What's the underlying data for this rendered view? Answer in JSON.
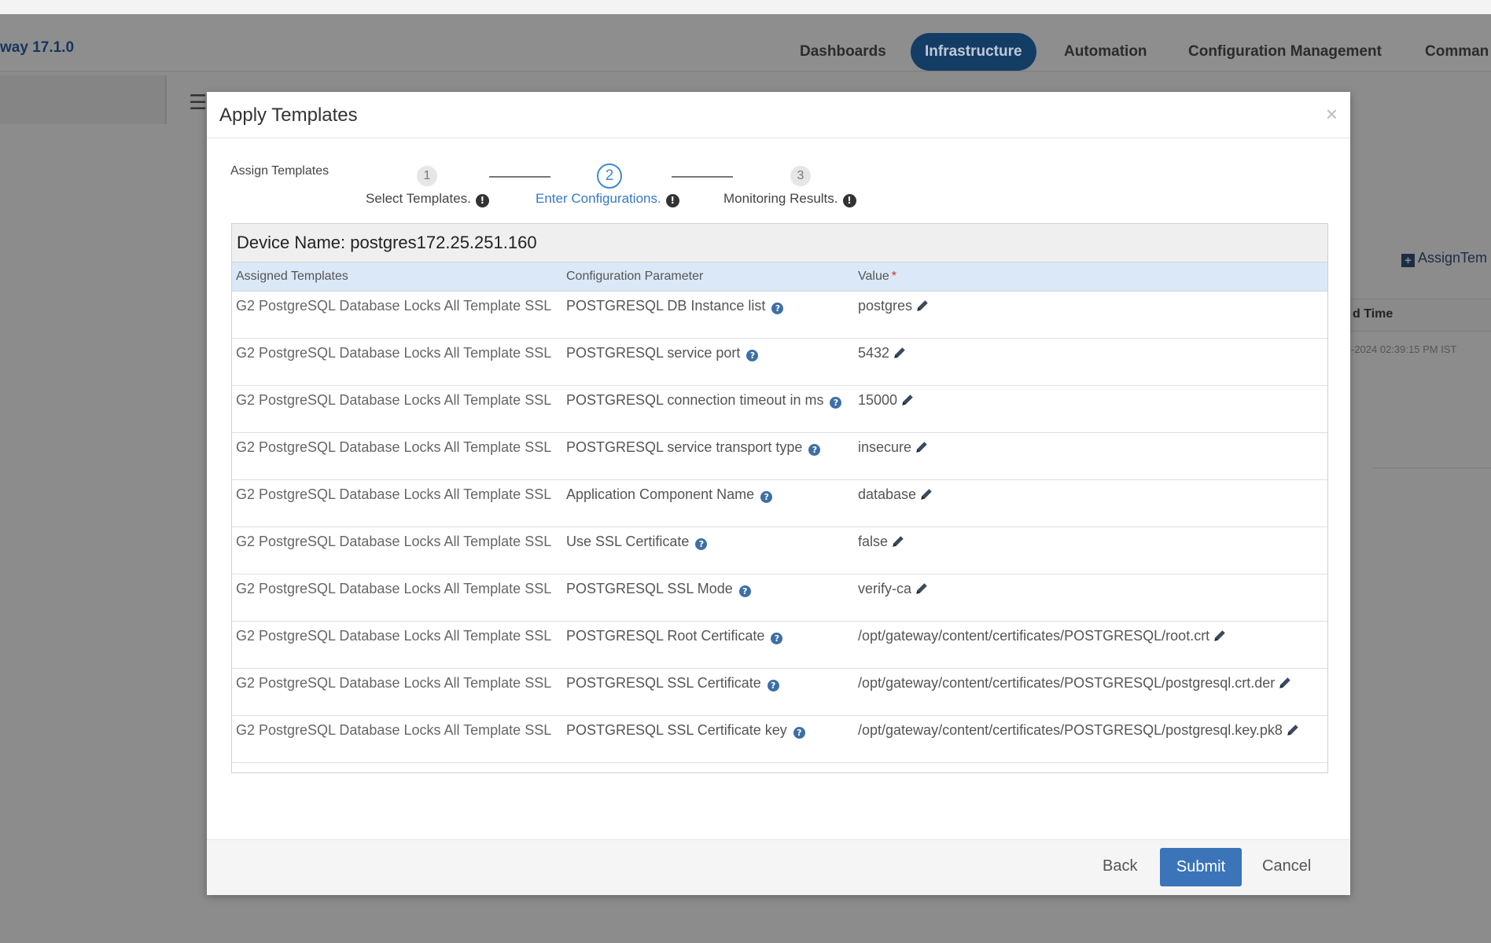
{
  "app": {
    "brand": "way 17.1.0"
  },
  "nav": {
    "items": [
      {
        "label": "Dashboards",
        "active": false
      },
      {
        "label": "Infrastructure",
        "active": true
      },
      {
        "label": "Automation",
        "active": false
      },
      {
        "label": "Configuration Management",
        "active": false
      },
      {
        "label": "Comman",
        "active": false
      }
    ]
  },
  "background": {
    "assign_label": "AssignTem",
    "column_header": "d Time",
    "cell": "-2024 02:39:15 PM IST"
  },
  "modal": {
    "title": "Apply Templates",
    "close_symbol": "×",
    "wizard": {
      "label": "Assign Templates",
      "steps": [
        {
          "number": "1",
          "label": "Select Templates.",
          "active": false
        },
        {
          "number": "2",
          "label": "Enter Configurations.",
          "active": true
        },
        {
          "number": "3",
          "label": "Monitoring Results.",
          "active": false
        }
      ]
    },
    "device_name": "Device Name: postgres172.25.251.160",
    "table": {
      "headers": {
        "template": "Assigned Templates",
        "parameter": "Configuration Parameter",
        "value": "Value"
      },
      "required_marker": "*",
      "rows": [
        {
          "template": "G2 PostgreSQL Database Locks All Template SSL",
          "parameter": "POSTGRESQL DB Instance list",
          "value": "postgres"
        },
        {
          "template": "G2 PostgreSQL Database Locks All Template SSL",
          "parameter": "POSTGRESQL service port",
          "value": "5432"
        },
        {
          "template": "G2 PostgreSQL Database Locks All Template SSL",
          "parameter": "POSTGRESQL connection timeout in ms",
          "value": "15000"
        },
        {
          "template": "G2 PostgreSQL Database Locks All Template SSL",
          "parameter": "POSTGRESQL service transport type",
          "value": "insecure"
        },
        {
          "template": "G2 PostgreSQL Database Locks All Template SSL",
          "parameter": "Application Component Name",
          "value": "database"
        },
        {
          "template": "G2 PostgreSQL Database Locks All Template SSL",
          "parameter": "Use SSL Certificate",
          "value": "false"
        },
        {
          "template": "G2 PostgreSQL Database Locks All Template SSL",
          "parameter": "POSTGRESQL SSL Mode",
          "value": "verify-ca"
        },
        {
          "template": "G2 PostgreSQL Database Locks All Template SSL",
          "parameter": "POSTGRESQL Root Certificate",
          "value": "/opt/gateway/content/certificates/POSTGRESQL/root.crt"
        },
        {
          "template": "G2 PostgreSQL Database Locks All Template SSL",
          "parameter": "POSTGRESQL SSL Certificate",
          "value": "/opt/gateway/content/certificates/POSTGRESQL/postgresql.crt.der"
        },
        {
          "template": "G2 PostgreSQL Database Locks All Template SSL",
          "parameter": "POSTGRESQL SSL Certificate key",
          "value": "/opt/gateway/content/certificates/POSTGRESQL/postgresql.key.pk8"
        }
      ]
    },
    "footer": {
      "back": "Back",
      "submit": "Submit",
      "cancel": "Cancel"
    }
  },
  "colors": {
    "accent": "#3b74b8",
    "nav_active": "#143d66",
    "table_header": "#dbe8f7"
  },
  "icons": {
    "info_dark": "info-circle-icon",
    "info_blue": "help-circle-icon",
    "edit": "pencil-icon",
    "close": "close-icon",
    "menu": "hamburger-menu-icon"
  }
}
